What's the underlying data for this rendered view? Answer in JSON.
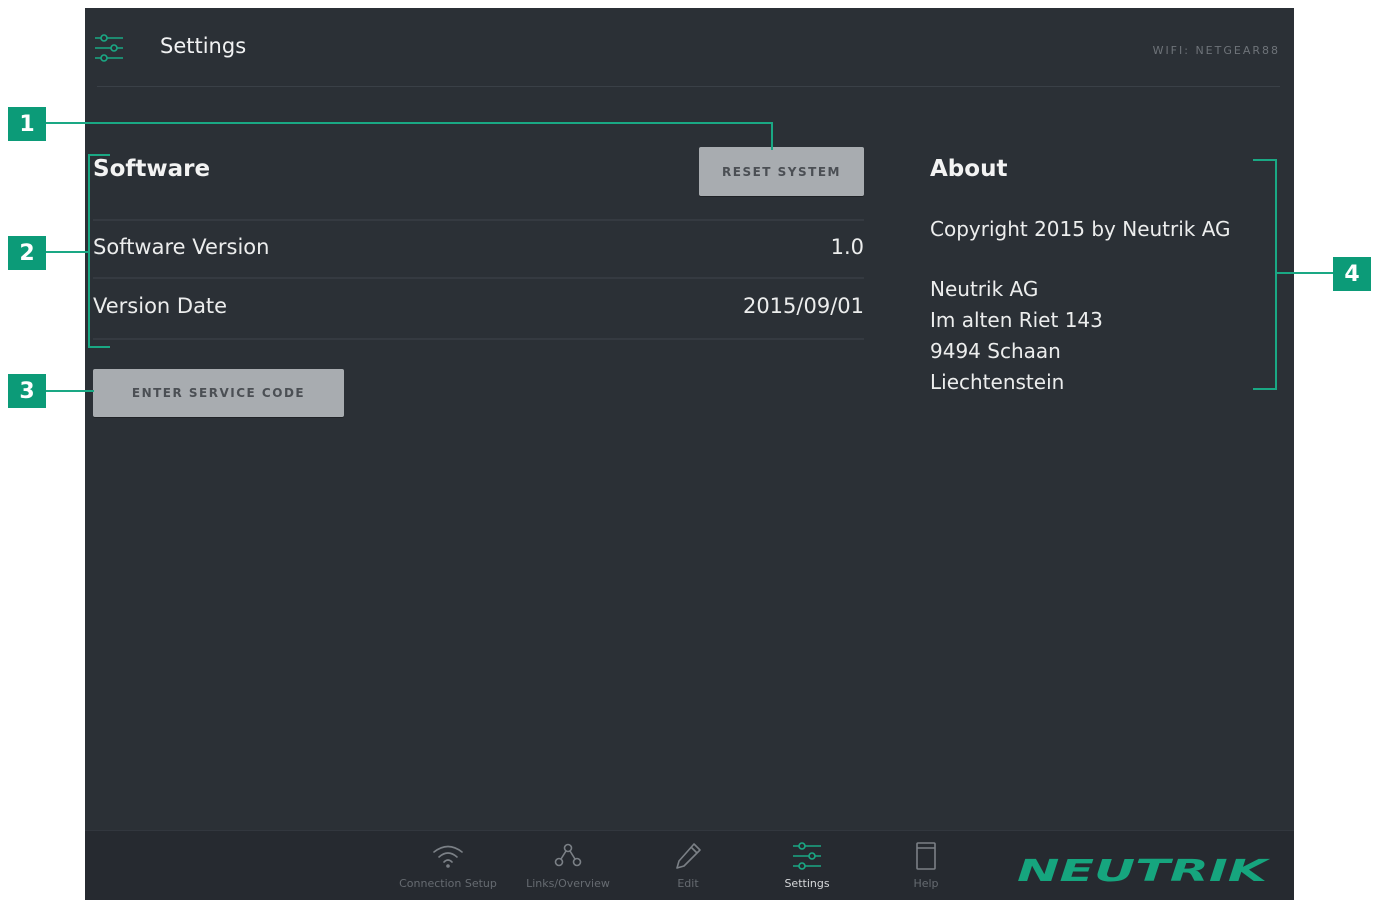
{
  "header": {
    "title": "Settings",
    "wifi": "WIFI: NETGEAR88"
  },
  "software": {
    "title": "Software",
    "reset_button": "RESET SYSTEM",
    "rows": [
      {
        "label": "Software Version",
        "value": "1.0"
      },
      {
        "label": "Version Date",
        "value": "2015/09/01"
      }
    ],
    "service_button": "ENTER SERVICE CODE"
  },
  "about": {
    "title": "About",
    "copyright": "Copyright 2015 by Neutrik AG",
    "address": [
      "Neutrik AG",
      "Im alten Riet 143",
      "9494 Schaan",
      "Liechtenstein"
    ]
  },
  "nav": {
    "items": [
      {
        "label": "Connection Setup",
        "icon": "wifi-icon"
      },
      {
        "label": "Links/Overview",
        "icon": "links-icon"
      },
      {
        "label": "Edit",
        "icon": "pencil-icon"
      },
      {
        "label": "Settings",
        "icon": "sliders-icon",
        "active": true
      },
      {
        "label": "Help",
        "icon": "book-icon"
      }
    ],
    "logo": "NEUTRIK"
  },
  "callouts": [
    "1",
    "2",
    "3",
    "4"
  ],
  "colors": {
    "background": "#2b3036",
    "accent": "#1aa884",
    "button": "#a8acb0",
    "callout": "#0c9b78"
  }
}
